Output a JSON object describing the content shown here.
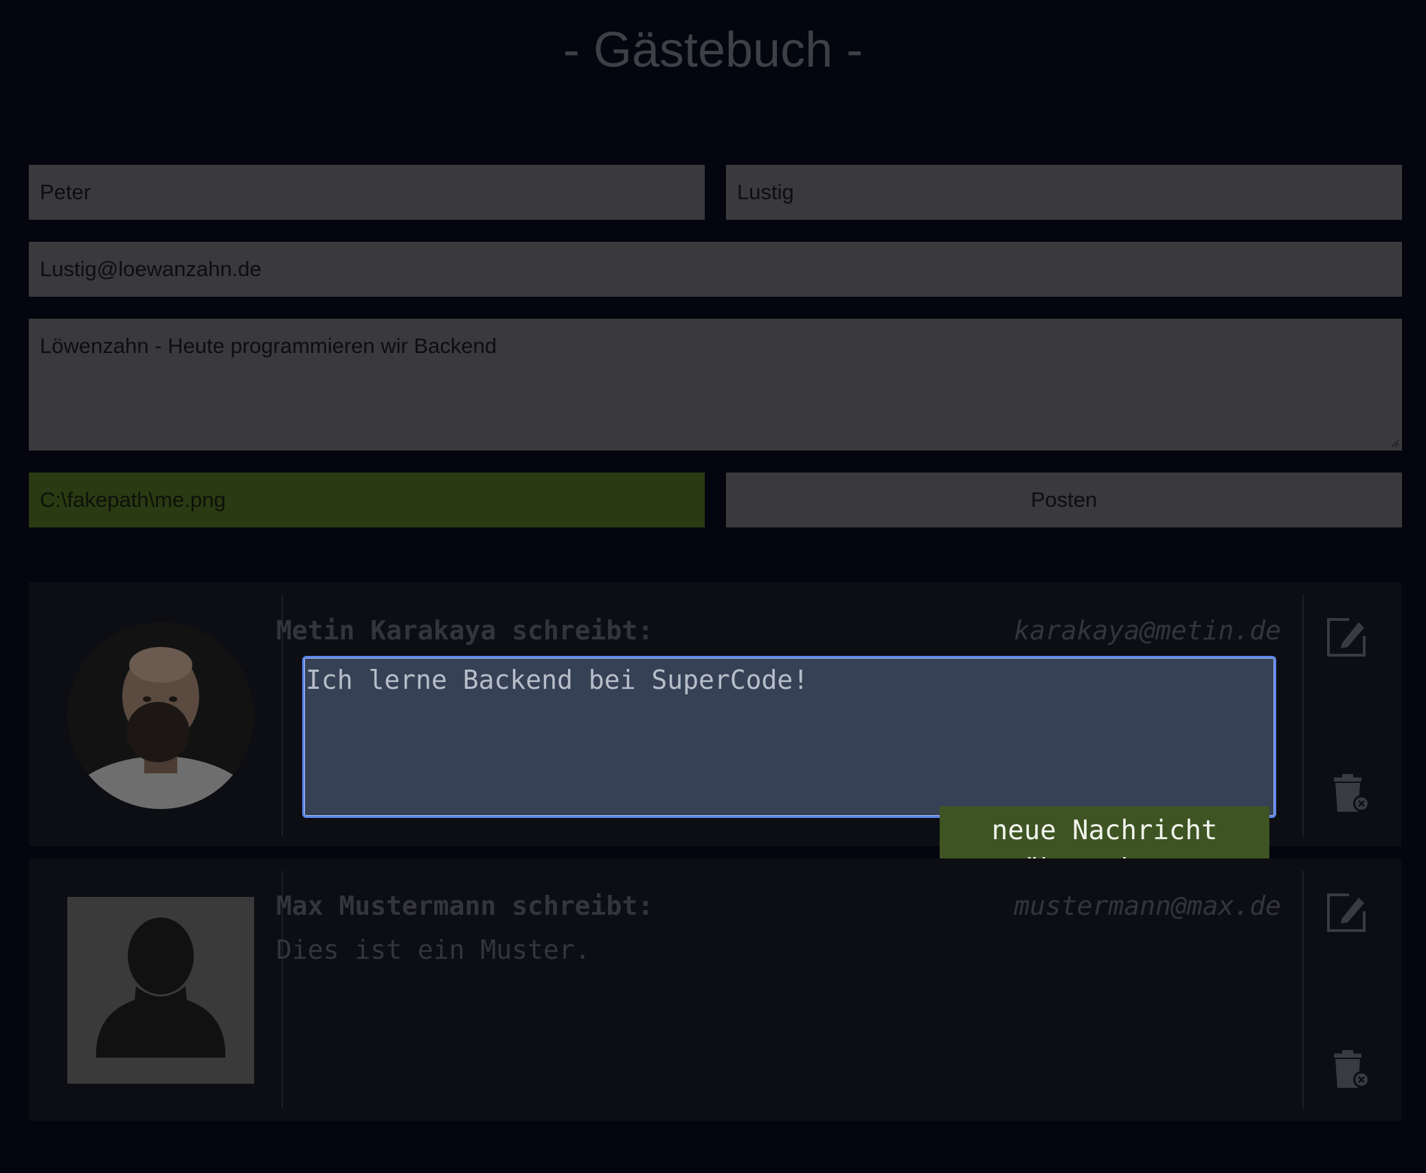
{
  "page": {
    "title": "- Gästebuch -"
  },
  "form": {
    "first_name": "Peter",
    "last_name": "Lustig",
    "email": "Lustig@loewanzahn.de",
    "message": "Löwenzahn - Heute programmieren wir Backend",
    "file": "C:\\fakepath\\me.png",
    "submit_label": "Posten"
  },
  "entries": [
    {
      "author": "Metin Karakaya schreibt:",
      "email": "karakaya@metin.de",
      "message": "Ich lerne Backend bei SuperCode!",
      "editing": true,
      "accept_label_line1": "neue Nachricht",
      "accept_label_line2": "übernehmen"
    },
    {
      "author": "Max Mustermann schreibt:",
      "email": "mustermann@max.de",
      "message": "Dies ist ein Muster.",
      "editing": false
    }
  ],
  "colors": {
    "background": "#05050f",
    "input_bg": "#3a3a3d",
    "file_bg": "#2a3a12",
    "edit_bg": "#364155",
    "accept_bg": "#3e5523"
  },
  "icons": [
    "edit-icon",
    "trash-icon",
    "avatar-placeholder-icon"
  ]
}
